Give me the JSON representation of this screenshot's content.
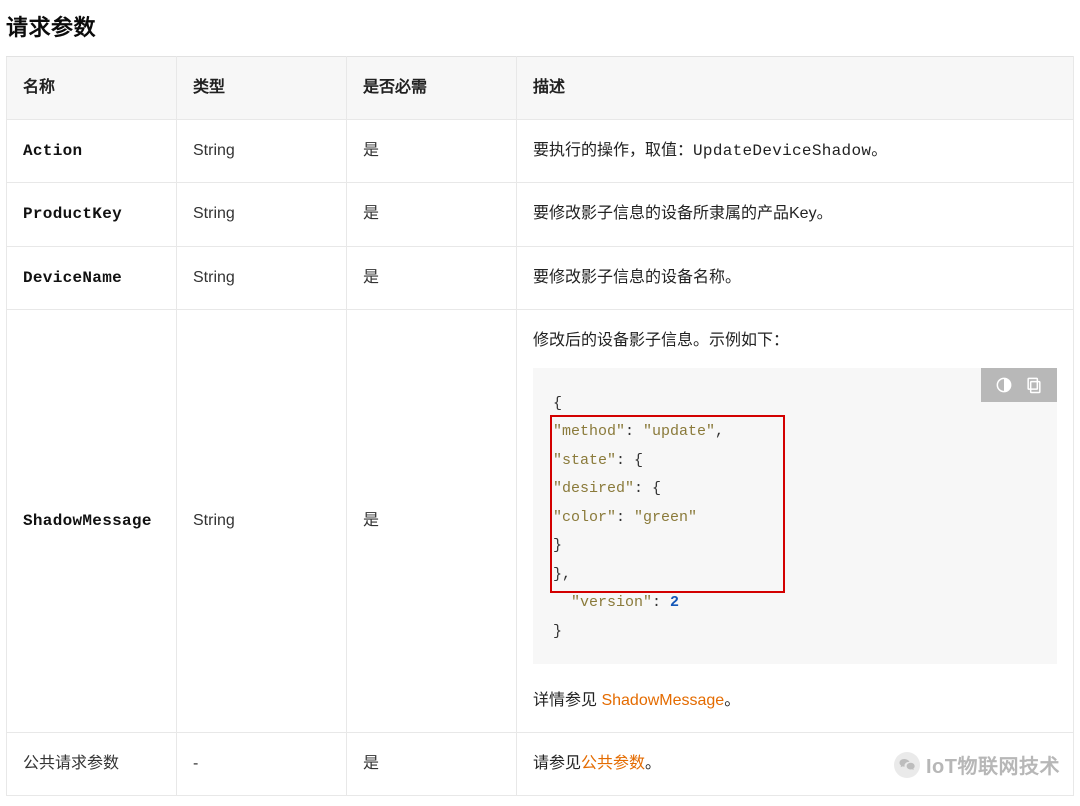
{
  "section": {
    "title": "请求参数"
  },
  "table": {
    "headers": {
      "name": "名称",
      "type": "类型",
      "required": "是否必需",
      "desc": "描述"
    },
    "rows": {
      "action": {
        "name": "Action",
        "type": "String",
        "required": "是",
        "desc_prefix": "要执行的操作，取值：",
        "desc_code": "UpdateDeviceShadow",
        "desc_suffix": "。"
      },
      "productKey": {
        "name": "ProductKey",
        "type": "String",
        "required": "是",
        "desc": "要修改影子信息的设备所隶属的产品Key。"
      },
      "deviceName": {
        "name": "DeviceName",
        "type": "String",
        "required": "是",
        "desc": "要修改影子信息的设备名称。"
      },
      "shadowMessage": {
        "name": "ShadowMessage",
        "type": "String",
        "required": "是",
        "intro": "修改后的设备影子信息。示例如下：",
        "code": {
          "line1": "{",
          "l2_key": "\"method\"",
          "l2_col": ": ",
          "l2_val": "\"update\"",
          "l2_end": ",",
          "l3_key": "\"state\"",
          "l3_col": ": ",
          "l3_val": "{",
          "l4_key": "\"desired\"",
          "l4_col": ": ",
          "l4_val": "{",
          "l5_key": "\"color\"",
          "l5_col": ": ",
          "l5_val": "\"green\"",
          "l6": "}",
          "l7": "},",
          "l8_pad": "  ",
          "l8_key": "\"version\"",
          "l8_col": ": ",
          "l8_val": "2",
          "l9": "}"
        },
        "detail_prefix": "详情参见 ",
        "detail_link": "ShadowMessage",
        "detail_suffix": "。"
      },
      "common": {
        "name": "公共请求参数",
        "type": "-",
        "required": "是",
        "desc_prefix": "请参见",
        "desc_link": "公共参数",
        "desc_suffix": "。"
      }
    }
  },
  "watermark": {
    "text": "IoT物联网技术"
  }
}
